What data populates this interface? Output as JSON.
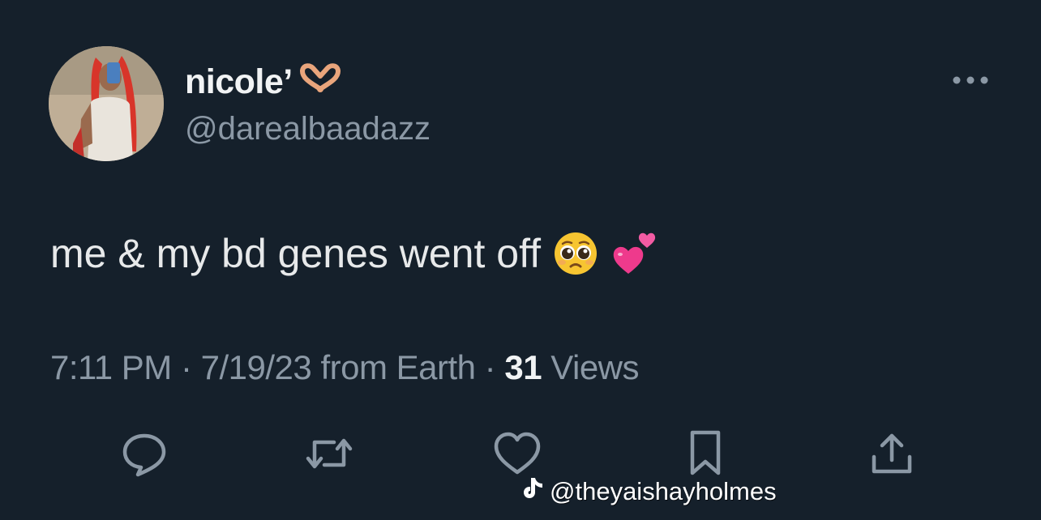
{
  "tweet": {
    "display_name": "nicole’",
    "name_emoji": "heart-hands-icon",
    "handle": "@darealbaadazz",
    "text": "me & my bd genes went off",
    "text_emojis": [
      "pleading-face-icon",
      "two-hearts-icon"
    ],
    "time": "7:11 PM",
    "separator": "·",
    "date": "7/19/23 from Earth",
    "views_count": "31",
    "views_label": "Views"
  },
  "actions": [
    {
      "name": "reply-icon"
    },
    {
      "name": "retweet-icon"
    },
    {
      "name": "like-icon"
    },
    {
      "name": "bookmark-icon"
    },
    {
      "name": "share-icon"
    }
  ],
  "watermark": {
    "icon": "tiktok-logo-icon",
    "handle": "@theyaishayholmes"
  },
  "colors": {
    "background": "#15202b",
    "primary_text": "#e7e9ea",
    "secondary_text": "#8b98a5"
  }
}
